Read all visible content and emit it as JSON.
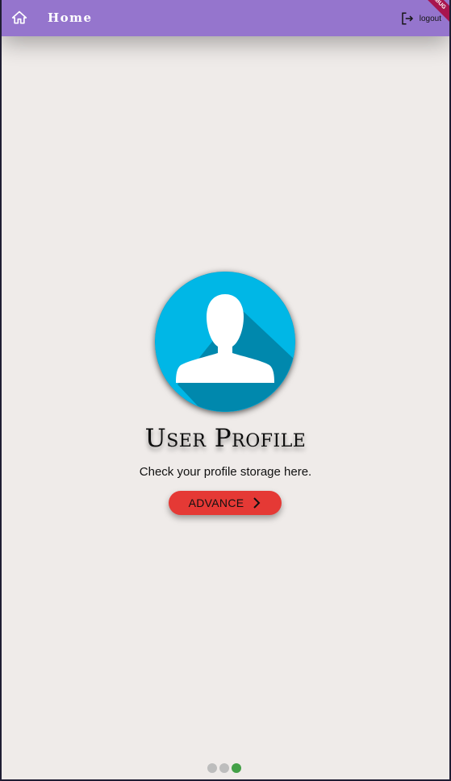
{
  "appbar": {
    "title": "Home",
    "logout_label": "logout",
    "home_icon": "home-icon",
    "logout_icon": "logout-icon",
    "debug_banner": "DEBUG",
    "color": "#9575cd"
  },
  "profile": {
    "title": "User Profile",
    "description": "Check your profile storage here.",
    "button_label": "ADVANCE",
    "button_icon": "chevron-right-icon",
    "avatar_icon": "user-silhouette-icon",
    "avatar_color": "#00b7e6",
    "button_color": "#e53935"
  },
  "pager": {
    "total": 3,
    "active_index": 2,
    "active_color": "#43a047"
  }
}
